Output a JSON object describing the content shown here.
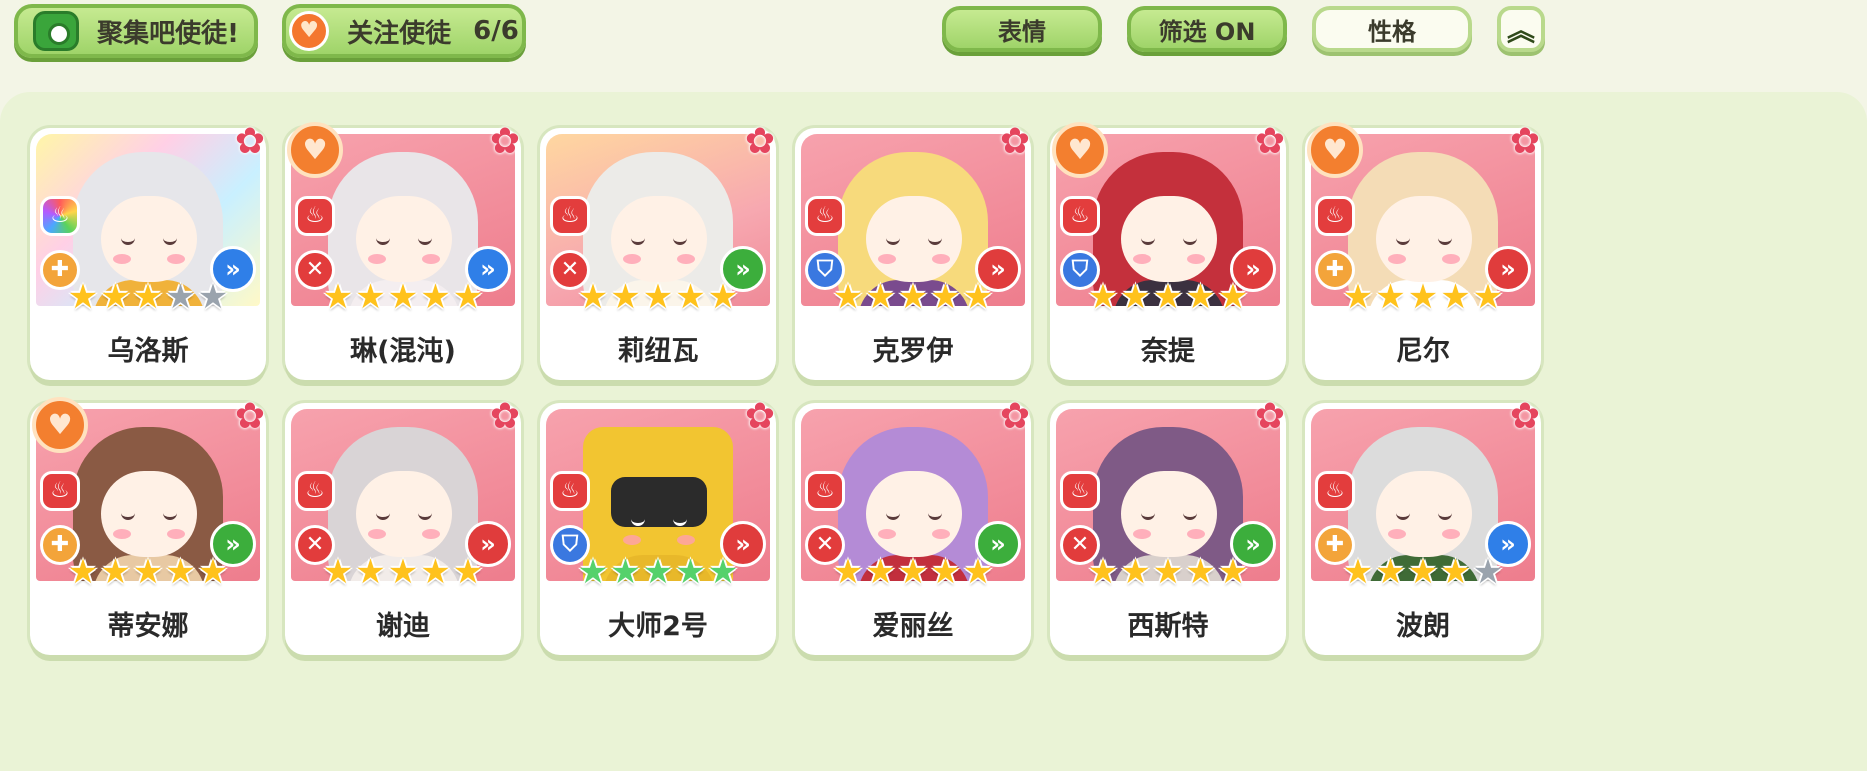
{
  "topbar": {
    "gather_label": "聚集吧使徒!",
    "follow_label": "关注使徒",
    "follow_count": "6/6",
    "emote_label": "表情",
    "filter_label": "筛选 ON",
    "personality_label": "性格",
    "collapse_icon": "double-chevron-up"
  },
  "colors": {
    "accent_green": "#9fd469",
    "card_pink": "#ee7d8d",
    "favorite_orange": "#f37f2f",
    "star_gold": "#ffc21c"
  },
  "cards": [
    {
      "name": "乌洛斯",
      "favorite": false,
      "element": "rainbow",
      "role": "heal",
      "arrow": "blue",
      "stars": 3,
      "max_stars": 5,
      "star_color": "gold",
      "bg": "rainbow",
      "hair": "#e6e6ea",
      "outfit": "#f0b23a"
    },
    {
      "name": "琳(混沌)",
      "favorite": true,
      "element": "fire",
      "role": "attack",
      "arrow": "blue",
      "stars": 5,
      "max_stars": 5,
      "star_color": "gold",
      "bg": "pink",
      "hair": "#e9e5e8",
      "outfit": "#f4eef0"
    },
    {
      "name": "莉纽瓦",
      "favorite": false,
      "element": "fire",
      "role": "attack",
      "arrow": "green",
      "stars": 5,
      "max_stars": 5,
      "star_color": "gold",
      "bg": "gold",
      "hair": "#ecebe8",
      "outfit": "#fbf5ea"
    },
    {
      "name": "克罗伊",
      "favorite": false,
      "element": "fire",
      "role": "defense",
      "arrow": "red",
      "stars": 5,
      "max_stars": 5,
      "star_color": "gold",
      "bg": "pink",
      "hair": "#f7da7c",
      "outfit": "#7a4b8e"
    },
    {
      "name": "奈提",
      "favorite": true,
      "element": "fire",
      "role": "defense",
      "arrow": "red",
      "stars": 5,
      "max_stars": 5,
      "star_color": "gold",
      "bg": "pink",
      "hair": "#c4303c",
      "outfit": "#3b3140"
    },
    {
      "name": "尼尔",
      "favorite": true,
      "element": "fire",
      "role": "heal",
      "arrow": "red",
      "stars": 5,
      "max_stars": 5,
      "star_color": "gold",
      "bg": "pink",
      "hair": "#f4dcb6",
      "outfit": "#ffffff"
    },
    {
      "name": "蒂安娜",
      "favorite": true,
      "element": "fire",
      "role": "heal",
      "arrow": "green",
      "stars": 5,
      "max_stars": 5,
      "star_color": "gold",
      "bg": "pink",
      "hair": "#8a5a44",
      "outfit": "#e8c9a3"
    },
    {
      "name": "谢迪",
      "favorite": false,
      "element": "fire",
      "role": "attack",
      "arrow": "red",
      "stars": 5,
      "max_stars": 5,
      "star_color": "gold",
      "bg": "pink",
      "hair": "#d9d4d6",
      "outfit": "#f2ece9"
    },
    {
      "name": "大师2号",
      "favorite": false,
      "element": "fire",
      "role": "defense",
      "arrow": "red",
      "stars": 5,
      "max_stars": 5,
      "star_color": "green",
      "bg": "pink",
      "hair": "#f2c531",
      "outfit": "#e8b82a",
      "robot": true
    },
    {
      "name": "爱丽丝",
      "favorite": false,
      "element": "fire",
      "role": "attack",
      "arrow": "green",
      "stars": 5,
      "max_stars": 5,
      "star_color": "gold",
      "bg": "pink",
      "hair": "#b48bd6",
      "outfit": "#c22f3d"
    },
    {
      "name": "西斯特",
      "favorite": false,
      "element": "fire",
      "role": "attack",
      "arrow": "green",
      "stars": 5,
      "max_stars": 5,
      "star_color": "gold",
      "bg": "pink",
      "hair": "#7f5a86",
      "outfit": "#d9d0cc"
    },
    {
      "name": "波朗",
      "favorite": false,
      "element": "fire",
      "role": "heal",
      "arrow": "blue",
      "stars": 4,
      "max_stars": 5,
      "star_color": "gold",
      "bg": "pink",
      "hair": "#dcdcdc",
      "outfit": "#3f6b36"
    }
  ]
}
